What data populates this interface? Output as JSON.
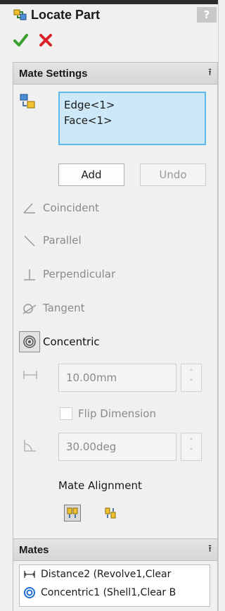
{
  "title": "Locate Part",
  "help_label": "?",
  "actions": {
    "ok_icon": "check-icon",
    "cancel_icon": "x-icon"
  },
  "mate_settings": {
    "header": "Mate Settings",
    "selections": [
      "Edge<1>",
      "Face<1>"
    ],
    "add_label": "Add",
    "undo_label": "Undo",
    "mate_types": [
      {
        "label": "Coincident",
        "icon": "coincident-icon",
        "active": false
      },
      {
        "label": "Parallel",
        "icon": "parallel-icon",
        "active": false
      },
      {
        "label": "Perpendicular",
        "icon": "perpendicular-icon",
        "active": false
      },
      {
        "label": "Tangent",
        "icon": "tangent-icon",
        "active": false
      },
      {
        "label": "Concentric",
        "icon": "concentric-icon",
        "active": true
      }
    ],
    "distance_value": "10.00mm",
    "flip_label": "Flip Dimension",
    "angle_value": "30.00deg",
    "alignment_label": "Mate Alignment",
    "alignment_options": [
      "aligned",
      "anti-aligned"
    ]
  },
  "mates": {
    "header": "Mates",
    "items": [
      {
        "label": "Distance2 (Revolve1,Clear",
        "icon": "distance-mate-icon"
      },
      {
        "label": "Concentric1 (Shell1,Clear B",
        "icon": "concentric-mate-icon"
      }
    ]
  },
  "colors": {
    "selection_fill": "#cde8f7",
    "selection_border": "#5fb6e8",
    "ok": "#3aa02e",
    "cancel": "#d9232a"
  }
}
